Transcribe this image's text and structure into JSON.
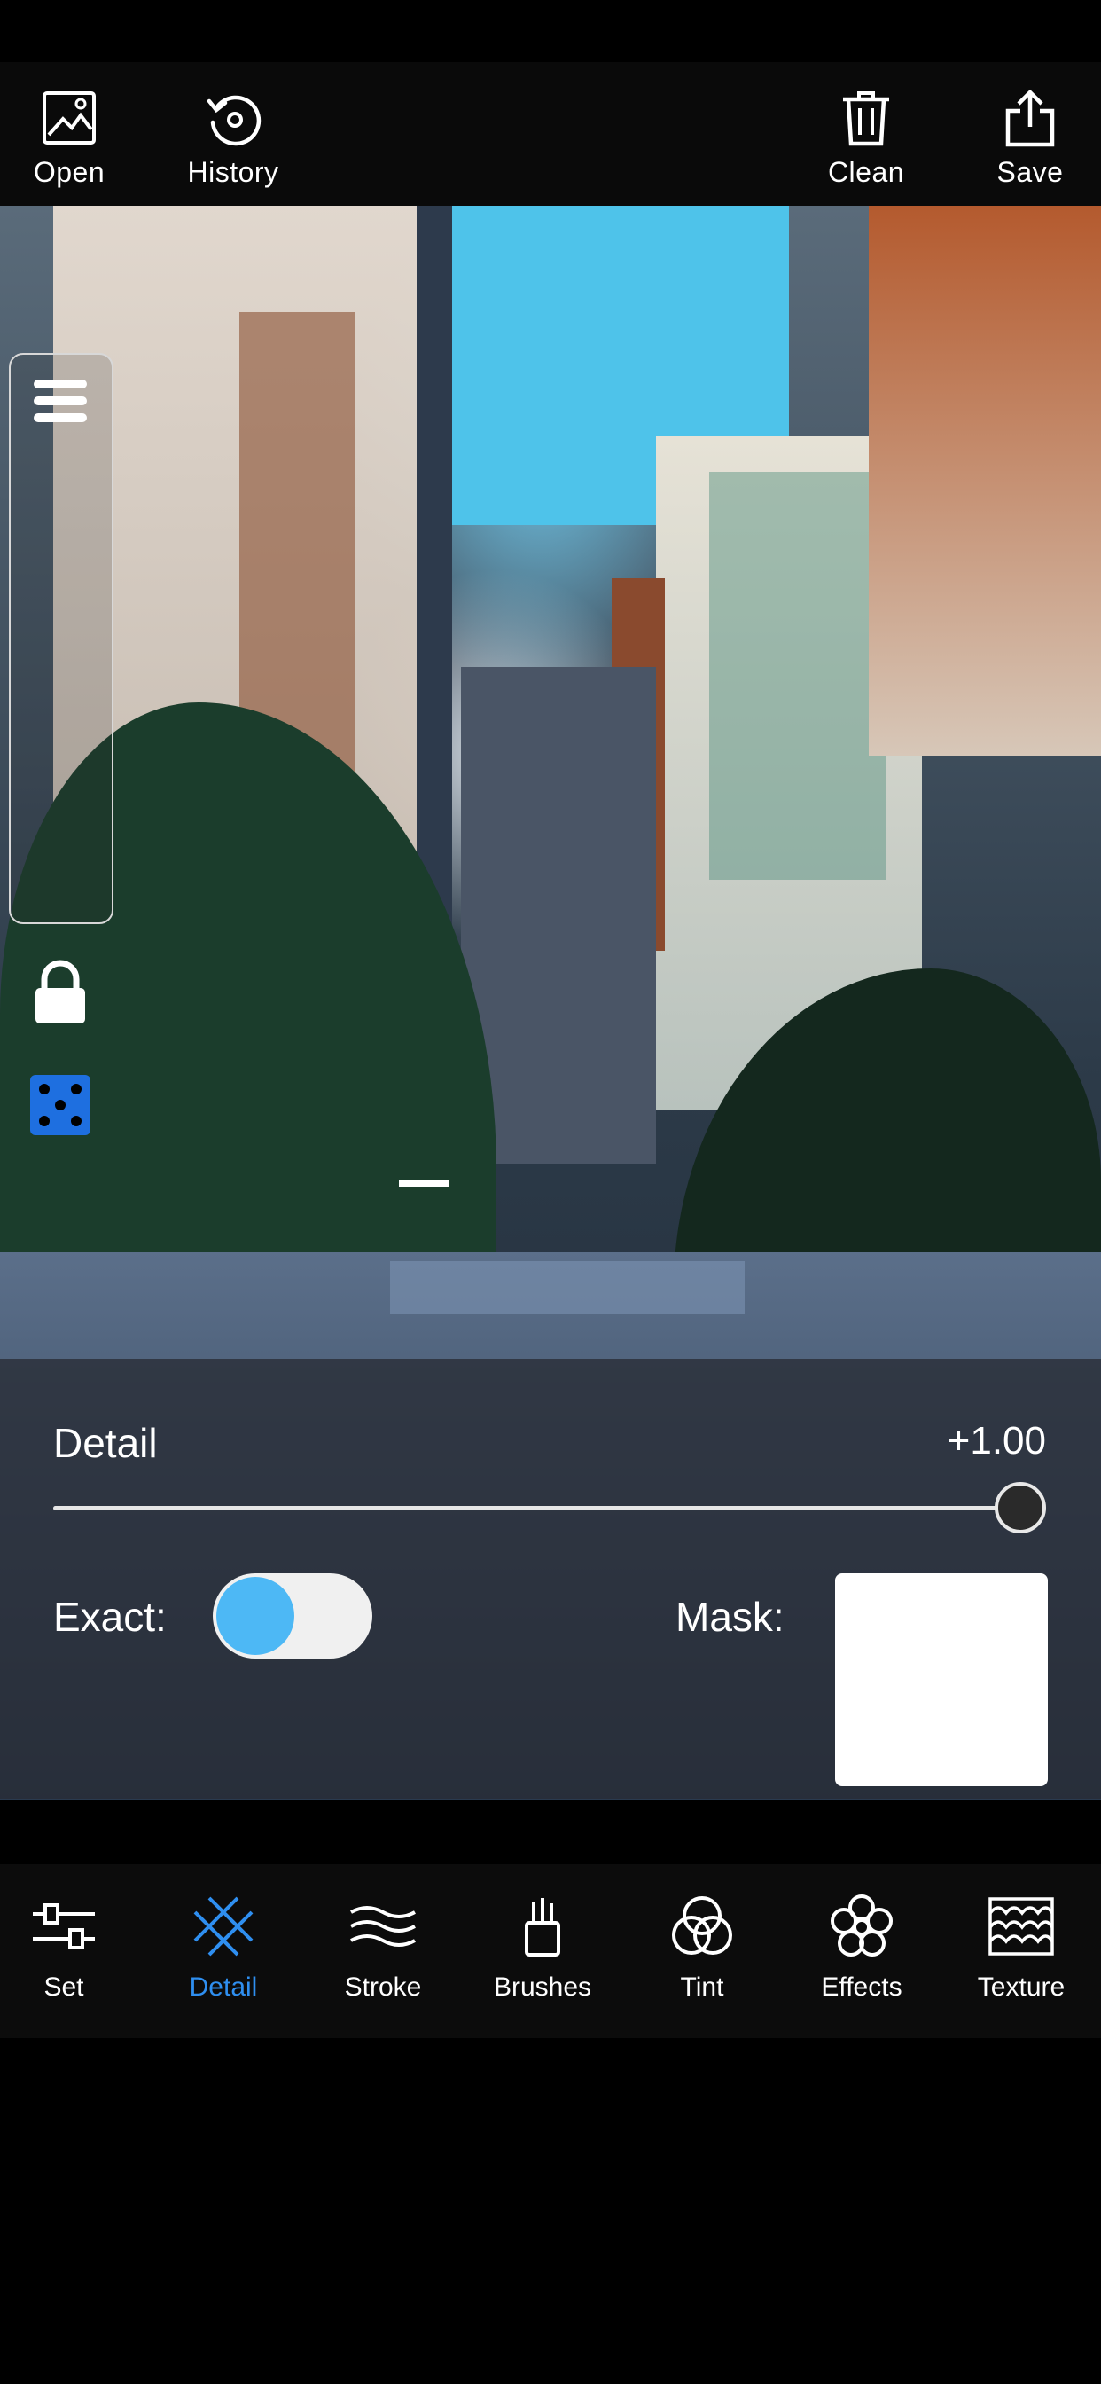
{
  "toolbar": {
    "open_label": "Open",
    "history_label": "History",
    "clean_label": "Clean",
    "save_label": "Save"
  },
  "canvas": {
    "icons": [
      "menu-icon",
      "lock-icon",
      "dice-icon"
    ]
  },
  "controls": {
    "detail_label": "Detail",
    "detail_value": "+1.00",
    "exact_label": "Exact:",
    "mask_label": "Mask:",
    "exact_enabled": true,
    "slider_fraction": 1.0,
    "mask_color": "#ffffff"
  },
  "tabs": [
    {
      "label": "Set",
      "icon": "sliders-icon"
    },
    {
      "label": "Detail",
      "icon": "crosshatch-icon",
      "active": true
    },
    {
      "label": "Stroke",
      "icon": "waves-icon"
    },
    {
      "label": "Brushes",
      "icon": "brush-icon"
    },
    {
      "label": "Tint",
      "icon": "circles-icon"
    },
    {
      "label": "Effects",
      "icon": "flower-icon"
    },
    {
      "label": "Texture",
      "icon": "scales-icon"
    }
  ],
  "colors": {
    "accent": "#2f8ff0",
    "toggle_knob": "#4db8f5",
    "dice": "#1e6fe0"
  }
}
